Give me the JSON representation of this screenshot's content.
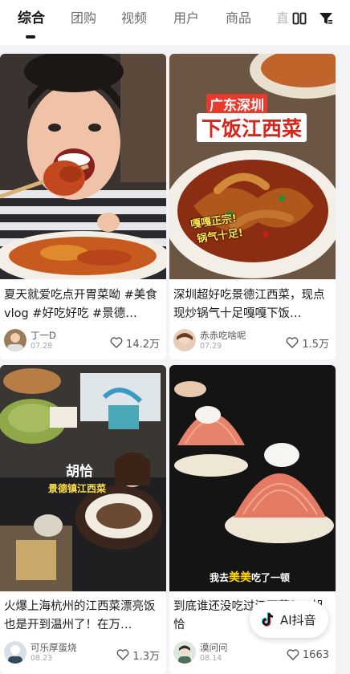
{
  "tabs": [
    {
      "label": "综合",
      "active": true
    },
    {
      "label": "团购",
      "active": false
    },
    {
      "label": "视频",
      "active": false
    },
    {
      "label": "用户",
      "active": false
    },
    {
      "label": "商品",
      "active": false
    },
    {
      "label": "直",
      "active": false
    }
  ],
  "toolbar": {
    "layout_icon": "grid-layout-icon",
    "filter_icon": "filter-icon"
  },
  "cards": [
    {
      "title": "夏天就爱吃点开胃菜呦 #美食vlog #好吃好吃 #景德…",
      "author": "丁一D",
      "date": "07.28",
      "likes": "14.2万"
    },
    {
      "title": "深圳超好吃景德江西菜，现点现炒锅气十足嘎嘎下饭…",
      "author": "赤赤吃啥呢",
      "date": "07.29",
      "likes": "1.5万",
      "overlay_top": "广东深圳",
      "overlay_main": "下饭江西菜",
      "overlay_badge_1": "嘎嘎正宗!",
      "overlay_badge_2": "锅气十足!"
    },
    {
      "title": "火爆上海杭州的江西菜漂亮饭也是开到温州了！在万…",
      "author": "可乐厚蛋烧",
      "date": "08.23",
      "likes": "1.3万",
      "overlay_name": "胡恰",
      "overlay_sub": "景德镇江西菜"
    },
    {
      "title": "到底谁还没吃过江西菜？#胡恰",
      "author": "漠问问",
      "date": "08.14",
      "likes": "1663",
      "overlay_prefix": "我去",
      "overlay_highlight": "美美",
      "overlay_suffix": "吃了一顿"
    }
  ],
  "ai_button": {
    "label": "AI抖音",
    "icon": "douyin-logo-icon"
  },
  "colors": {
    "accent_yellow": "#ffd400",
    "brand_red": "#e83a2b",
    "text_primary": "#1a1a1a",
    "text_secondary": "#55575c"
  }
}
